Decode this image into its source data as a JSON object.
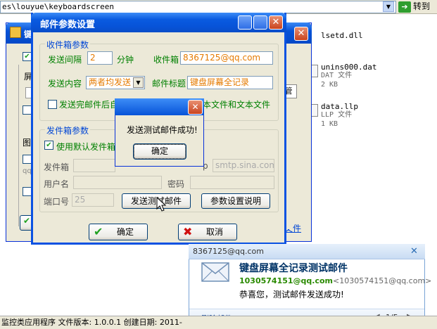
{
  "address_bar": {
    "path": "es\\louyue\\keyboardscreen",
    "go_label": "转到"
  },
  "right_pane": {
    "top_file": "lsetd.dll",
    "files": [
      {
        "name": "unins000.dat",
        "type": "DAT 文件",
        "size": "2 KB"
      },
      {
        "name": "data.llp",
        "type": "LLP 文件",
        "size": "1 KB"
      }
    ],
    "partial_text": "文件"
  },
  "status_bar": {
    "text": "监控类应用程序 文件版本: 1.0.0.1 创建日期: 2011-"
  },
  "bg_window": {
    "title_fragment": "键",
    "label_ping": "屏",
    "label_tu": "图",
    "label_qq": "qq",
    "partial_link": "文件",
    "partial_btn": "管"
  },
  "dialog": {
    "title": "邮件参数设置",
    "receive_group": {
      "label": "收件箱参数",
      "interval_label": "发送间隔",
      "interval_value": "2",
      "interval_unit": "分钟",
      "inbox_label": "收件箱",
      "inbox_value": "8367125@qq.com",
      "content_label": "发送内容",
      "content_value": "两者均发送",
      "subject_label": "邮件标题",
      "subject_value": "键盘屏幕全记录",
      "delete_prefix": "发送完邮件后自",
      "delete_suffix": "本文件和文本文件"
    },
    "send_group": {
      "label": "发件箱参数",
      "default_label": "使用默认发件箱",
      "outbox_label": "发件箱",
      "smtp_suffix": "p",
      "smtp_value": "smtp.sina.com",
      "username_label": "用户名",
      "password_label": "密码",
      "port_label": "端口号",
      "port_value": "25",
      "test_button": "发送测试邮件",
      "help_button": "参数设置说明"
    },
    "ok_button": "确定",
    "cancel_button": "取消"
  },
  "popup": {
    "message": "发送测试邮件成功!",
    "ok_button": "确定"
  },
  "notification": {
    "account": "8367125@qq.com",
    "subject": "键盘屏幕全记录测试邮件",
    "sender_email": "1030574151@qq.com",
    "sender_full": "<1030574151@qq.com>",
    "body": "恭喜您，测试邮件发送成功!",
    "delete_link": "删除邮件",
    "page": "1/5"
  },
  "colors": {
    "xp_blue": "#0a52e2",
    "label_green": "#008000",
    "group_blue": "#0046d5",
    "orange": "#e57a00"
  }
}
